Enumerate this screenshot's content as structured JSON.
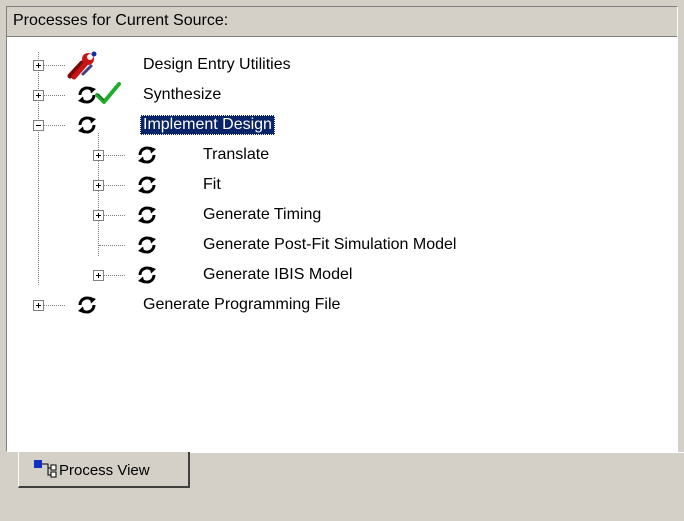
{
  "panel": {
    "title": "Processes for Current Source:"
  },
  "tree": {
    "design_entry_utilities": "Design Entry Utilities",
    "synthesize": "Synthesize",
    "implement_design": "Implement Design",
    "translate": "Translate",
    "fit": "Fit",
    "generate_timing": "Generate Timing",
    "generate_post_fit_sim": "Generate Post-Fit Simulation Model",
    "generate_ibis": "Generate IBIS Model",
    "generate_programming_file": "Generate Programming File"
  },
  "tabs": {
    "process_view": "Process View"
  },
  "icons": {
    "tools": "tools-icon",
    "process": "process-cycle-icon",
    "done": "checkmark-icon"
  },
  "colors": {
    "selection": "#0a246a",
    "check": "#1fae2a",
    "tools_red": "#c81414"
  }
}
